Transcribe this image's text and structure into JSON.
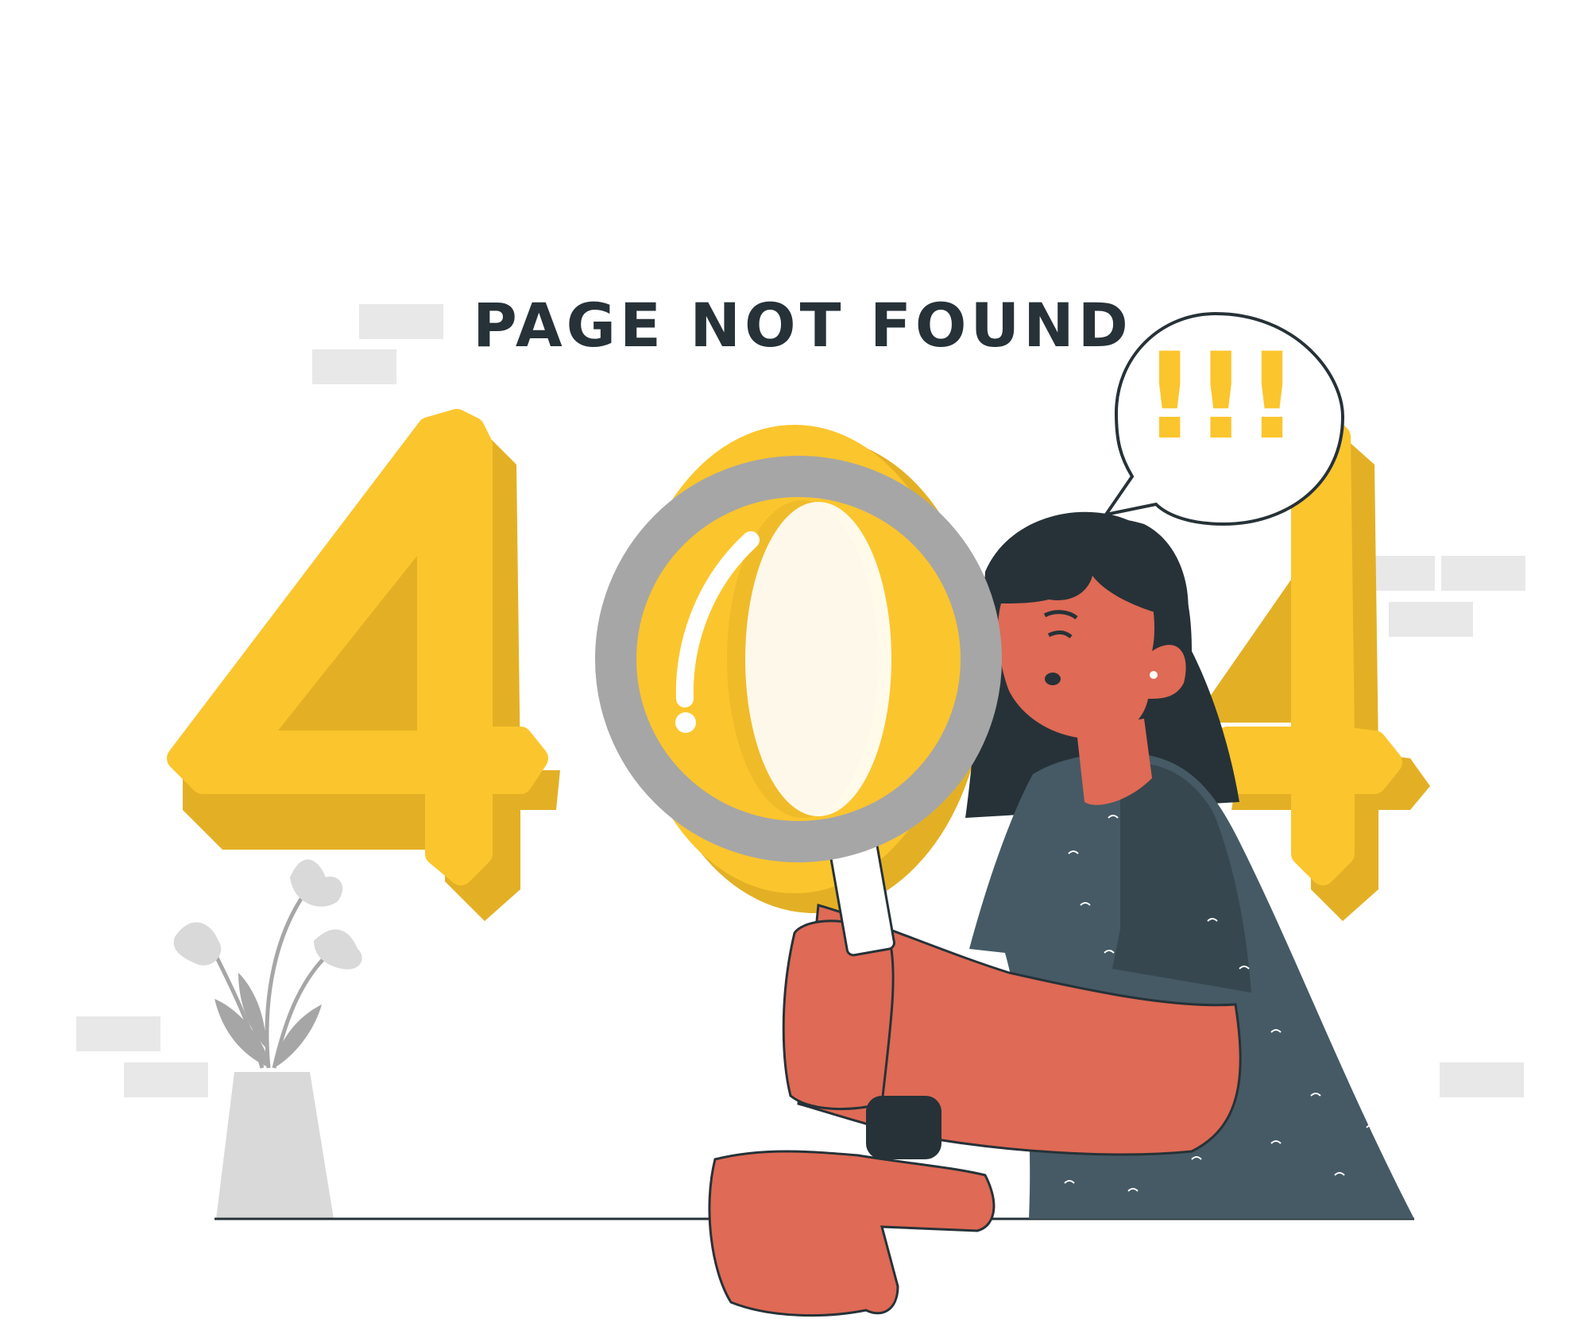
{
  "message": {
    "title": "PAGE NOT FOUND",
    "error_code": "404",
    "exclamation": "!!!"
  },
  "illustration": {
    "subject": "woman-with-magnifying-glass",
    "icons": [
      "magnifying-glass-icon",
      "speech-bubble-icon",
      "plant-vase-icon"
    ]
  },
  "colors": {
    "text_dark": "#263238",
    "yellow": "#FBC52D",
    "yellow_shadow": "#E3B025",
    "skin": "#DF6A55",
    "hair": "#263238",
    "shirt": "#455A64",
    "lens_ring": "#A6A6A6",
    "brick_gray": "#E8E8E8",
    "vase_gray": "#D9D9D9"
  }
}
